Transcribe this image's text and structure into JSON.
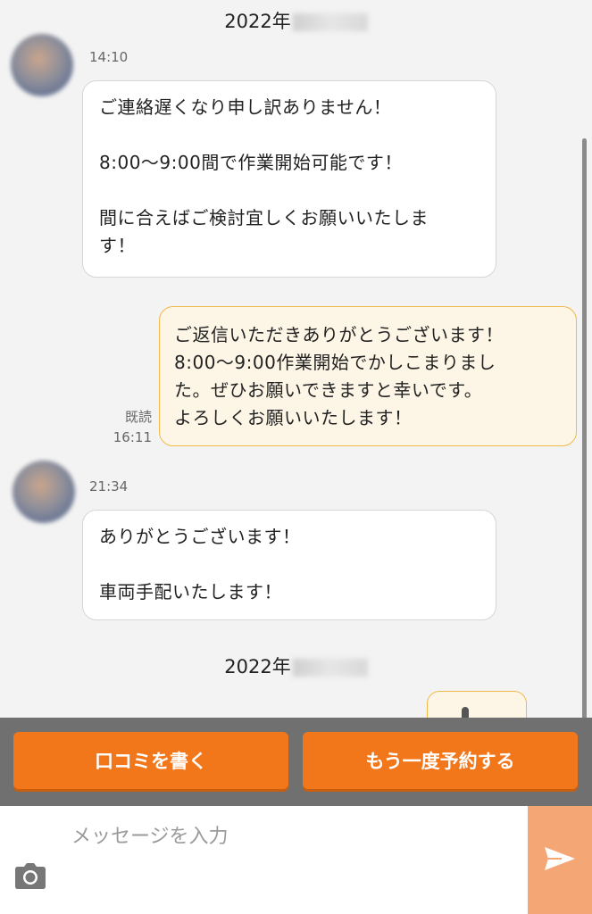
{
  "dates": [
    {
      "label": "2022年"
    },
    {
      "label": "2022年"
    }
  ],
  "messages": [
    {
      "time": "14:10",
      "text": "ご連絡遅くなり申し訳ありません！\n\n8:00〜9:00間で作業開始可能です！\n\n間に合えばご検討宜しくお願いいたしま\nす！"
    },
    {
      "read": "既読",
      "time": "16:11",
      "text": "ご返信いただきありがとうございます！\n8:00〜9:00作業開始でかしこまりまし\nた。ぜひお願いできますと幸いです。\nよろしくお願いいたします！"
    },
    {
      "time": "21:34",
      "text": "ありがとうございます！\n\n車両手配いたします！"
    }
  ],
  "actions": {
    "review_label": "口コミを書く",
    "rebook_label": "もう一度予約する"
  },
  "input": {
    "placeholder": "メッセージを入力",
    "value": ""
  },
  "colors": {
    "accent": "#f2761a",
    "send_button": "#f4a775",
    "outgoing_border": "#f0b94a",
    "outgoing_bg": "#fdf6e6"
  },
  "icons": {
    "camera": "camera-icon",
    "send": "send-icon"
  }
}
